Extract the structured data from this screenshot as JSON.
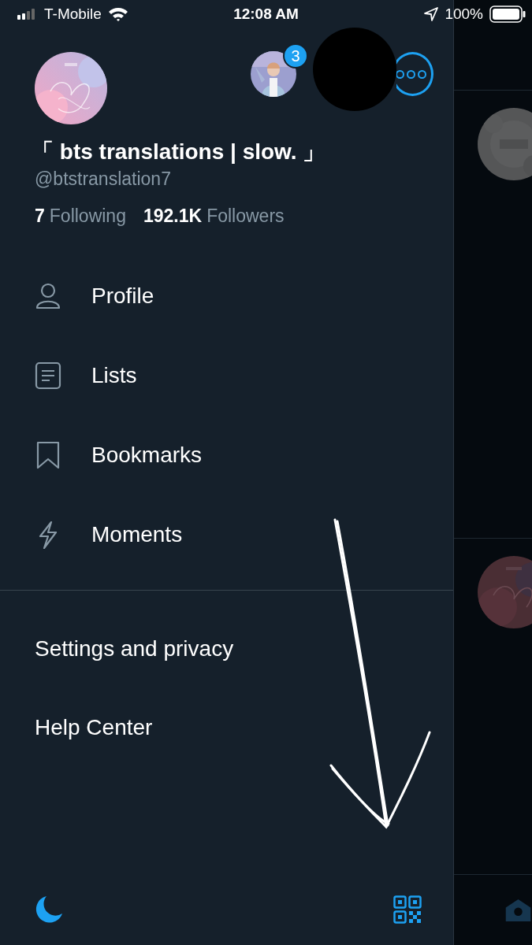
{
  "status_bar": {
    "carrier": "T-Mobile",
    "time": "12:08 AM",
    "battery": "100%"
  },
  "account_switcher": {
    "badge": "3"
  },
  "profile": {
    "name": "「 bts translations | slow. 」",
    "handle": "@btstranslation7",
    "following_count": "7",
    "following_label": "Following",
    "followers_count": "192.1K",
    "followers_label": "Followers"
  },
  "menu": [
    {
      "label": "Profile"
    },
    {
      "label": "Lists"
    },
    {
      "label": "Bookmarks"
    },
    {
      "label": "Moments"
    }
  ],
  "secondary_menu": [
    {
      "label": "Settings and privacy"
    },
    {
      "label": "Help Center"
    }
  ]
}
